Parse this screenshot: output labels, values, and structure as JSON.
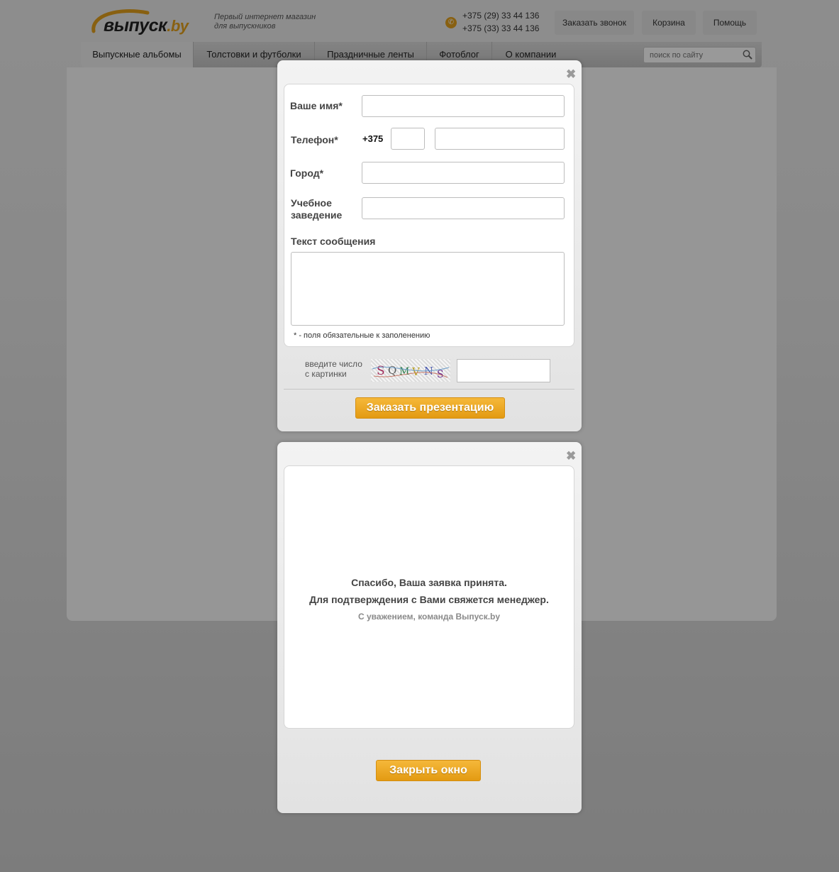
{
  "header": {
    "logo_main": "выпуск",
    "logo_suffix": ".by",
    "tagline_line1": "Первый интернет магазин",
    "tagline_line2": "для выпускников",
    "phone1": "+375 (29) 33 44 136",
    "phone2": "+375 (33) 33 44 136",
    "buttons": {
      "callback": "Заказать звонок",
      "cart": "Корзина",
      "help": "Помощь"
    }
  },
  "nav": {
    "items": [
      {
        "label": "Выпускные альбомы",
        "active": true
      },
      {
        "label": "Толстовки и футболки",
        "active": false
      },
      {
        "label": "Праздничные ленты",
        "active": false
      },
      {
        "label": "Фотоблог",
        "active": false
      },
      {
        "label": "О компании",
        "active": false
      }
    ],
    "search_placeholder": "поиск по сайту"
  },
  "form_modal": {
    "close_symbol": "✖",
    "name_label": "Ваше имя*",
    "phone_label": "Телефон*",
    "phone_code": "+375",
    "city_label": "Город*",
    "school_label_line1": "Учебное",
    "school_label_line2": "заведение",
    "message_label": "Текст сообщения",
    "required_note": "* - поля обязательные к заполенению",
    "captcha_label_line1": "введите число",
    "captcha_label_line2": "с картинки",
    "captcha_text": "SQMVNS",
    "submit_label": "Заказать презентацию"
  },
  "thanks_modal": {
    "close_symbol": "✖",
    "line1": "Спасибо, Ваша заявка принята.",
    "line2": "Для подтверждения с Вами свяжется менеджер.",
    "line3": "С уважением, команда Выпуск.by",
    "close_button_label": "Закрыть окно"
  },
  "colors": {
    "accent": "#e3a11d",
    "button_top": "#f5b83a",
    "button_bottom": "#e39a12"
  }
}
